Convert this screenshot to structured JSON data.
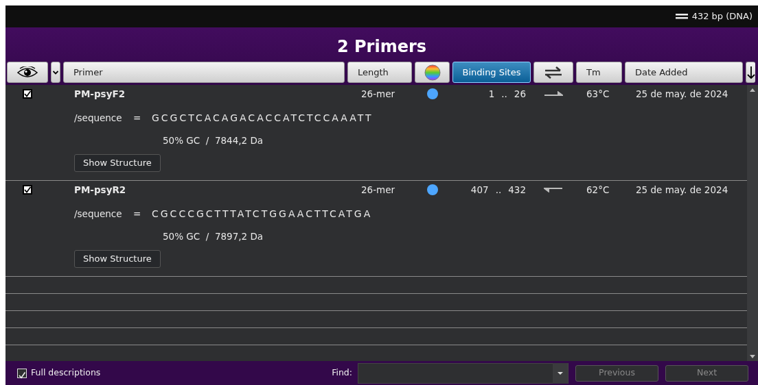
{
  "status_bar": {
    "length": "432 bp  (DNA)"
  },
  "title": "2 Primers",
  "columns": [
    {
      "kind": "eye",
      "selected": false
    },
    {
      "kind": "menu",
      "selected": false
    },
    {
      "kind": "text",
      "label": "Primer",
      "selected": false
    },
    {
      "kind": "text",
      "label": "Length",
      "selected": false
    },
    {
      "kind": "color",
      "selected": false
    },
    {
      "kind": "text",
      "label": "Binding Sites",
      "selected": true
    },
    {
      "kind": "direction",
      "selected": false
    },
    {
      "kind": "text",
      "label": "Tm",
      "selected": false
    },
    {
      "kind": "text",
      "label": "Date Added",
      "selected": false
    },
    {
      "kind": "sort",
      "selected": false
    }
  ],
  "primers": [
    {
      "checked": true,
      "name": "PM-psyF2",
      "length": "26-mer",
      "color": "#4da6ff",
      "start": "1",
      "range_sep": "..",
      "end": "26",
      "kind": "forward",
      "tm": "63°C",
      "date": "25 de may. de 2024",
      "qualifier": "/sequence",
      "equals": "=",
      "sequence": "GCGCTCACAGACACCATCTCCAAATT",
      "stats": "50% GC  /  7844,2 Da",
      "button": "Show Structure"
    },
    {
      "checked": true,
      "name": "PM-psyR2",
      "length": "26-mer",
      "color": "#4da6ff",
      "start": "407",
      "range_sep": "..",
      "end": "432",
      "kind": "reverse",
      "tm": "62°C",
      "date": "25 de may. de 2024",
      "qualifier": "/sequence",
      "equals": "=",
      "sequence": "CGCCCGCTTTATCTGGAACTTCATGA",
      "stats": "50% GC  /  7897,2 Da",
      "button": "Show Structure"
    }
  ],
  "footer": {
    "full_descriptions": {
      "label": "Full descriptions",
      "checked": true
    },
    "find_label": "Find:",
    "buttons": [
      {
        "label": "Previous",
        "disabled": true
      },
      {
        "label": "Next",
        "disabled": true
      }
    ]
  }
}
